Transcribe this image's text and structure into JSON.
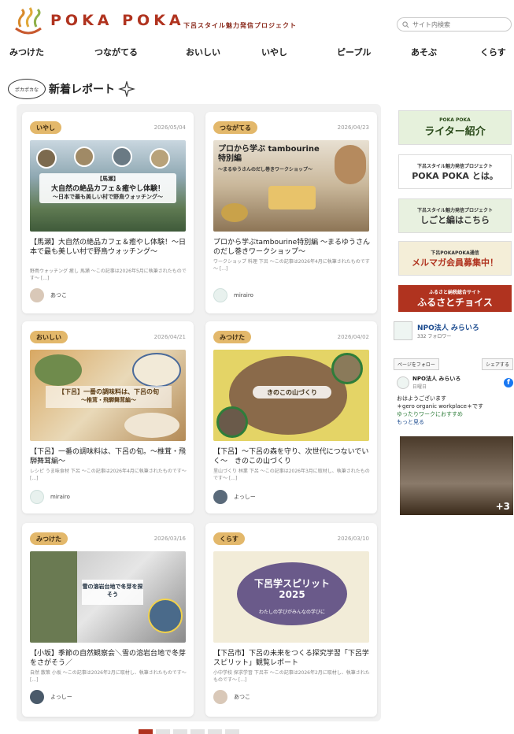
{
  "site": {
    "logo_text": "POKA POKA",
    "tagline": "下呂スタイル魅力発信プロジェクト",
    "search_placeholder": "サイト内検索"
  },
  "nav": {
    "items": [
      "みつけた",
      "つながてる",
      "おいしい",
      "いやし",
      "ピープル",
      "あそぶ",
      "くらす"
    ]
  },
  "section": {
    "bubble": "ポカポカな",
    "title": "新着レポート"
  },
  "cards": [
    {
      "tag": "いやし",
      "date": "2026/05/04",
      "title": "【馬瀬】大自然の絶品カフェ＆癒やし体験！～日本で最も美しい村で野鳥ウォッチング～",
      "excerpt": "野鳥ウォッチング 癒し 馬瀬 ～この記事は2026年5月に執筆されたものです～ [...]",
      "author": "あつこ",
      "thumb_tag": "【馬瀬】",
      "thumb_title": "大自然の絶品カフェ＆癒やし体験！",
      "thumb_sub": "～日本で最も美しい村で野鳥ウォッチング～"
    },
    {
      "tag": "つながてる",
      "date": "2026/04/23",
      "title": "プロから学ぶtambourine特別編 ～まるゆうさんのだし巻きワークショップ～",
      "excerpt": "ワークショップ 料理 下呂 ～この記事は2026年4月に執筆されたものです～ [...]",
      "author": "mirairo",
      "thumb_title": "プロから学ぶ tambourine特別編",
      "thumb_sub": "～まるゆうさんのだし巻きワークショップ～"
    },
    {
      "tag": "おいしい",
      "date": "2026/04/21",
      "title": "【下呂】一番の調味料は、下呂の旬。～椎茸・飛騨舞茸編～",
      "excerpt": "レシピ うま味食材 下呂 ～この記事は2026年4月に執筆されたものです～ [...]",
      "author": "mirairo",
      "thumb_title": "【下呂】一番の調味料は、下呂の旬",
      "thumb_sub": "～椎茸・飛騨舞茸編～"
    },
    {
      "tag": "みつけた",
      "date": "2026/04/02",
      "title": "【下呂】～下呂の森を守り、次世代につないでいく～　きのこの山づくり",
      "excerpt": "里山づくり 林業 下呂 ～この記事は2026年3月に取材し、執筆されたものです～ [...]",
      "author": "よっしー",
      "thumb_title": "きのこの山づくり"
    },
    {
      "tag": "みつけた",
      "date": "2026/03/16",
      "title": "【小坂】季節の自然観察会＼雪の溶岩台地で冬芽をさがそう／",
      "excerpt": "自然 散策 小坂 ～この記事は2026年2月に取材し、執筆されたものです～ [...]",
      "author": "よっしー",
      "thumb_title": "雪の溶岩台地で冬芽を探そう"
    },
    {
      "tag": "くらす",
      "date": "2026/03/10",
      "title": "【下呂市】下呂の未来をつくる探究学習「下呂学スピリット」観覧レポート",
      "excerpt": "小中学校 探求学習 下呂市 ～この記事は2026年2月に取材し、執筆されたものです～ [...]",
      "author": "あつこ",
      "thumb_title": "下呂学スピリット 2025",
      "thumb_sub": "わたしの学びがみんなの学びに"
    }
  ],
  "sidebar": {
    "banners": [
      {
        "small": "POKA POKA",
        "main": "ライター紹介"
      },
      {
        "small": "下呂スタイル魅力発信プロジェクト",
        "main": "POKA POKA とは。"
      },
      {
        "small": "下呂スタイル魅力発信プロジェクト",
        "main": "しごと編はこちら"
      },
      {
        "small": "下呂POKAPOKA通信",
        "main": "メルマガ会員募集中！"
      },
      {
        "small": "ふるさと納税総合サイト",
        "main": "ふるさとチョイス"
      }
    ],
    "fb": {
      "page_name": "NPO法人 みらいろ",
      "followers": "332 フォロワー",
      "follow_btn": "ページをフォロー",
      "share_btn": "シェアする",
      "post_name": "NPO法人 みらいろ",
      "post_date": "日曜日",
      "post_line1": "おはようございます",
      "post_line2": "＊gero organic workplace＊です",
      "post_line3": "ゆったりワークにおすすめ",
      "post_more": "もっと見る",
      "photo_count": "+3"
    }
  },
  "colors": {
    "brand": "#b0331f",
    "tag": "#e3b86b"
  }
}
